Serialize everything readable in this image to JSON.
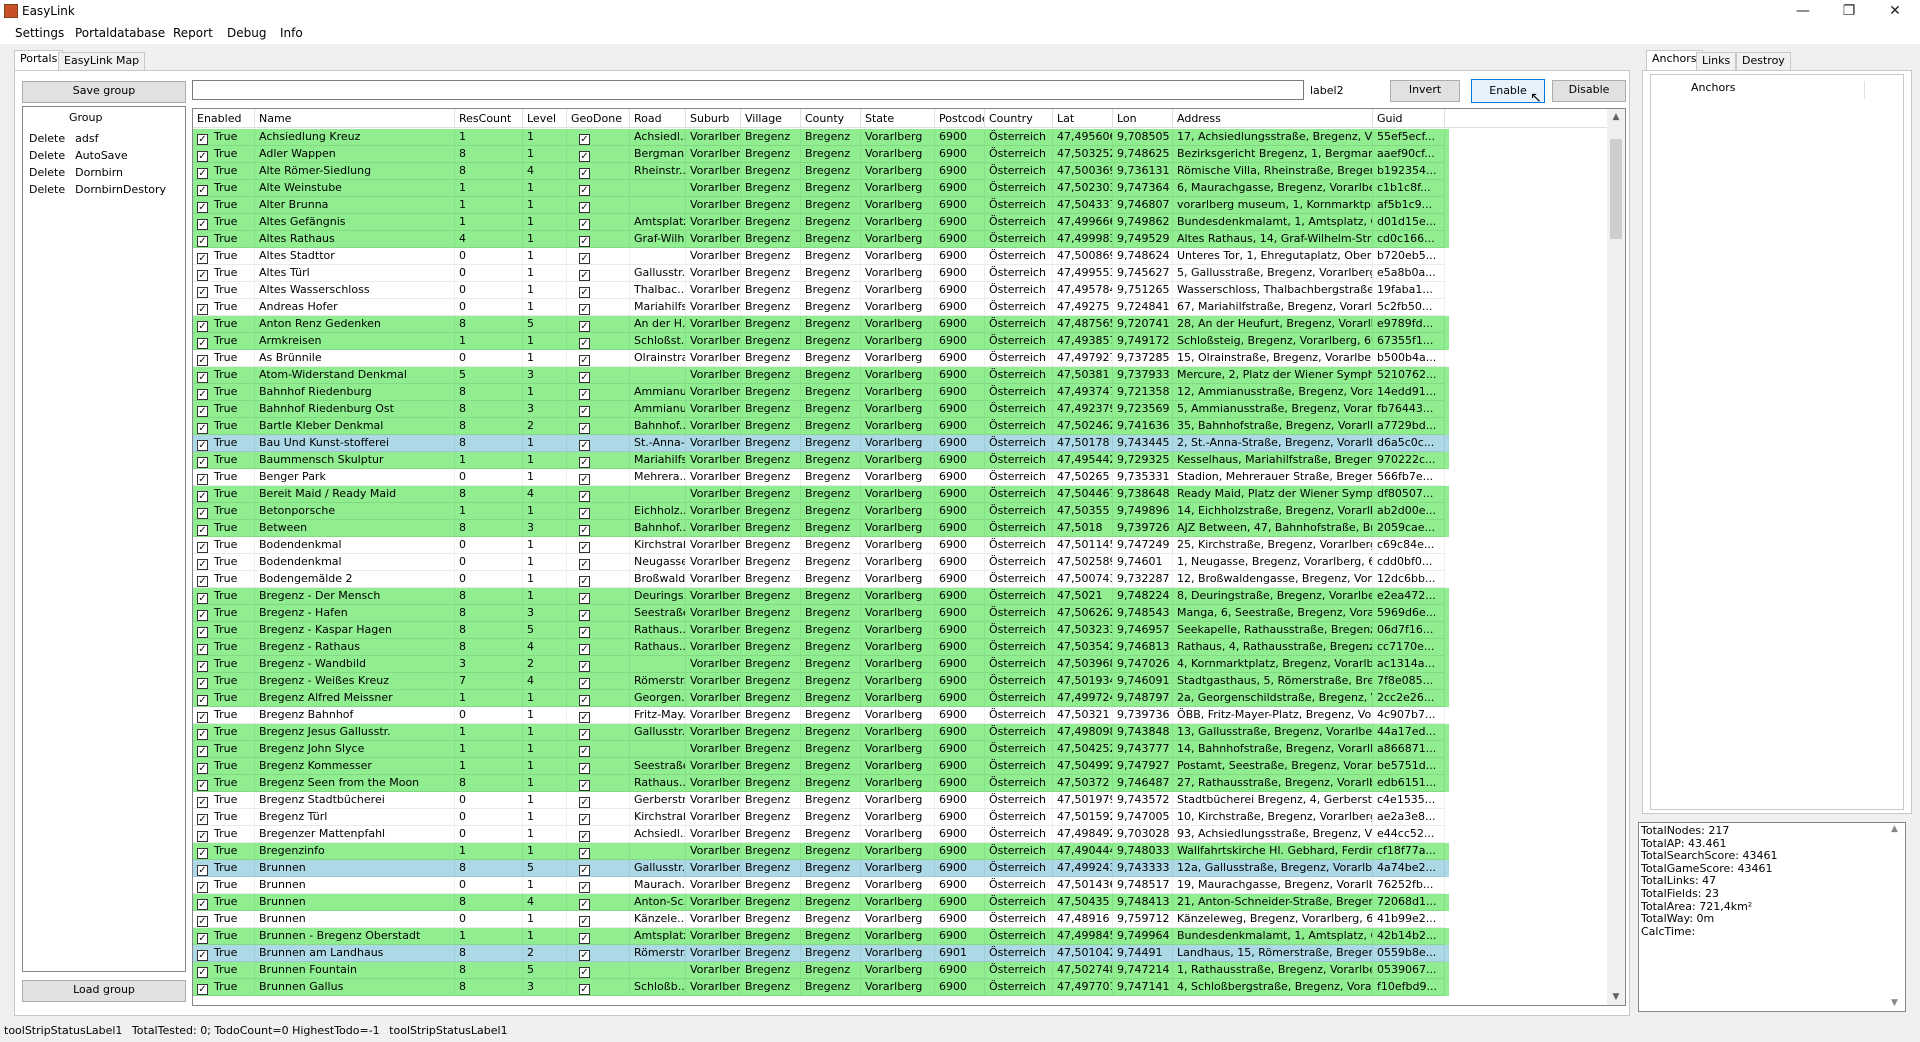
{
  "window": {
    "title": "EasyLink",
    "minimize_icon": "minimize-icon",
    "maximize_icon": "restore-icon",
    "close_icon": "close-icon"
  },
  "menu": [
    "Settings",
    "Portaldatabase",
    "Report",
    "Debug",
    "Info"
  ],
  "tabs": {
    "portals": "Portals",
    "map": "EasyLink Map"
  },
  "toolbar": {
    "save_group": "Save group",
    "search_value": "",
    "label2": "label2",
    "invert": "Invert",
    "enable": "Enable",
    "disable": "Disable",
    "load_group": "Load group"
  },
  "groups": {
    "header": "Group",
    "items": [
      {
        "action": "Delete",
        "name": "adsf"
      },
      {
        "action": "Delete",
        "name": "AutoSave"
      },
      {
        "action": "Delete",
        "name": "Dornbirn"
      },
      {
        "action": "Delete",
        "name": "DornbirnDestory"
      }
    ]
  },
  "grid": {
    "columns": [
      "Enabled",
      "Name",
      "ResCount",
      "Level",
      "GeoDone",
      "Road",
      "Suburb",
      "Village",
      "County",
      "State",
      "Postcode",
      "Country",
      "Lat",
      "Lon",
      "Address",
      "Guid"
    ],
    "rows": [
      {
        "e": "True",
        "n": "Achsiedlung Kreuz",
        "r": "1",
        "l": "1",
        "road": "Achsiedl...",
        "lat": "47,495606",
        "lon": "9,708505",
        "addr": "17, Achsiedlungsstraße, Bregenz, Vorarlb...",
        "guid": "55ef5ecf...",
        "pc": "6900",
        "bg": "green"
      },
      {
        "e": "True",
        "n": "Adler Wappen",
        "r": "8",
        "l": "1",
        "road": "Bergman...",
        "lat": "47,503252",
        "lon": "9,748625",
        "addr": "Bezirksgericht Bregenz, 1, Bergmannstraß...",
        "guid": "aaef90cf...",
        "pc": "6900",
        "bg": "green"
      },
      {
        "e": "True",
        "n": "Alte Römer-Siedlung",
        "r": "8",
        "l": "4",
        "road": "Rheinstr...",
        "lat": "47,500369",
        "lon": "9,736131",
        "addr": "Römische Villa, Rheinstraße, Bregenz, Vor...",
        "guid": "b192354...",
        "pc": "6900",
        "bg": "green"
      },
      {
        "e": "True",
        "n": "Alte Weinstube",
        "r": "1",
        "l": "1",
        "road": "",
        "lat": "47,502303",
        "lon": "9,747364",
        "addr": "6, Maurachgasse, Bregenz, Vorarlberg, 69...",
        "guid": "c1b1c8f...",
        "pc": "6900",
        "bg": "green"
      },
      {
        "e": "True",
        "n": "Alter Brunna",
        "r": "1",
        "l": "1",
        "road": "",
        "lat": "47,504337",
        "lon": "9,746807",
        "addr": "vorarlberg museum, 1, Kornmarktplatz, Bre...",
        "guid": "af5b1c9...",
        "pc": "6900",
        "bg": "green"
      },
      {
        "e": "True",
        "n": "Altes Gefängnis",
        "r": "1",
        "l": "1",
        "road": "Amtsplatz",
        "lat": "47,499666",
        "lon": "9,749862",
        "addr": "Bundesdenkmalamt, 1, Amtsplatz, Obersta...",
        "guid": "d01d15e...",
        "pc": "6900",
        "bg": "green"
      },
      {
        "e": "True",
        "n": "Altes Rathaus",
        "r": "4",
        "l": "1",
        "road": "Graf-Wilh...",
        "lat": "47,499983",
        "lon": "9,749529",
        "addr": "Altes Rathaus, 14, Graf-Wilhelm-Straße, O...",
        "guid": "cd0c166...",
        "pc": "6900",
        "bg": "green"
      },
      {
        "e": "True",
        "n": "Altes Stadttor",
        "r": "0",
        "l": "1",
        "road": "",
        "lat": "47,500869",
        "lon": "9,748624",
        "addr": "Unteres Tor, 1, Ehregutaplatz, Oberstadt, ...",
        "guid": "b720eb5...",
        "pc": "6900",
        "bg": "white"
      },
      {
        "e": "True",
        "n": "Altes Türl",
        "r": "0",
        "l": "1",
        "road": "Gallusstr...",
        "lat": "47,499553",
        "lon": "9,745627",
        "addr": "5, Gallusstraße, Bregenz, Vorarlberg, 6900...",
        "guid": "e5a8b0a...",
        "pc": "6900",
        "bg": "white"
      },
      {
        "e": "True",
        "n": "Altes Wasserschloss",
        "r": "0",
        "l": "1",
        "road": "Thalbac...",
        "lat": "47,495784",
        "lon": "9,751265",
        "addr": "Wasserschloss, Thalbachbergstraße, Bre...",
        "guid": "19faba1...",
        "pc": "6900",
        "bg": "white"
      },
      {
        "e": "True",
        "n": "Andreas Hofer",
        "r": "0",
        "l": "1",
        "road": "Mariahilfs...",
        "lat": "47,49275",
        "lon": "9,724841",
        "addr": "67, Mariahilfstraße, Bregenz, Vorarlberg, 6...",
        "guid": "5c2fb50...",
        "pc": "6900",
        "bg": "white"
      },
      {
        "e": "True",
        "n": "Anton Renz Gedenken",
        "r": "8",
        "l": "5",
        "road": "An der H...",
        "lat": "47,487565",
        "lon": "9,720741",
        "addr": "28, An der Heufurt, Bregenz, Vorarlberg, 6...",
        "guid": "e9789fd...",
        "pc": "6900",
        "bg": "green"
      },
      {
        "e": "True",
        "n": "Armkreisen",
        "r": "1",
        "l": "1",
        "road": "Schloßst...",
        "lat": "47,493857",
        "lon": "9,749172",
        "addr": "Schloßsteig, Bregenz, Vorarlberg, 6900, O...",
        "guid": "67355f1...",
        "pc": "6900",
        "bg": "green"
      },
      {
        "e": "True",
        "n": "As Brünnile",
        "r": "0",
        "l": "1",
        "road": "Olrainstra...",
        "lat": "47,497927",
        "lon": "9,737285",
        "addr": "15, Olrainstraße, Bregenz, Vorarlberg, 690...",
        "guid": "b500b4a...",
        "pc": "6900",
        "bg": "white"
      },
      {
        "e": "True",
        "n": "Atom-Widerstand Denkmal",
        "r": "5",
        "l": "3",
        "road": "",
        "lat": "47,50381",
        "lon": "9,737933",
        "addr": "Mercure, 2, Platz der Wiener Symphoniker...",
        "guid": "5210762...",
        "pc": "6900",
        "bg": "green"
      },
      {
        "e": "True",
        "n": "Bahnhof Riedenburg",
        "r": "8",
        "l": "1",
        "road": "Ammianu...",
        "lat": "47,493747",
        "lon": "9,721358",
        "addr": "12, Ammianusstraße, Bregenz, Vorarlberg,...",
        "guid": "14edd91...",
        "pc": "6900",
        "bg": "green"
      },
      {
        "e": "True",
        "n": "Bahnhof Riedenburg Ost",
        "r": "8",
        "l": "3",
        "road": "Ammianu...",
        "lat": "47,492379",
        "lon": "9,723569",
        "addr": "5, Ammianusstraße, Bregenz, Vorarlberg, ...",
        "guid": "fb76443...",
        "pc": "6900",
        "bg": "green"
      },
      {
        "e": "True",
        "n": "Bartle Kleber Denkmal",
        "r": "8",
        "l": "2",
        "road": "Bahnhof...",
        "lat": "47,502462",
        "lon": "9,741636",
        "addr": "35, Bahnhofstraße, Bregenz, Vorarlberg, 6...",
        "guid": "a7729bd...",
        "pc": "6900",
        "bg": "green"
      },
      {
        "e": "True",
        "n": "Bau Und Kunst-stofferei",
        "r": "8",
        "l": "1",
        "road": "St.-Anna-...",
        "lat": "47,50178",
        "lon": "9,743445",
        "addr": "2, St.-Anna-Straße, Bregenz, Vorarlberg, 6...",
        "guid": "d6a5c0c...",
        "pc": "6900",
        "bg": "blue"
      },
      {
        "e": "True",
        "n": "Baummensch Skulptur",
        "r": "1",
        "l": "1",
        "road": "Mariahilfs...",
        "lat": "47,495442",
        "lon": "9,729325",
        "addr": "Kesselhaus, Mariahilfstraße, Bregenz, Vor...",
        "guid": "970222c...",
        "pc": "6900",
        "bg": "green"
      },
      {
        "e": "True",
        "n": "Benger Park",
        "r": "0",
        "l": "1",
        "road": "Mehrera...",
        "lat": "47,50265",
        "lon": "9,735331",
        "addr": "Stadion, Mehrerauer Straße, Bregenz, V...",
        "guid": "566fb7e...",
        "pc": "6900",
        "bg": "white"
      },
      {
        "e": "True",
        "n": "Bereit Maid / Ready Maid",
        "r": "8",
        "l": "4",
        "road": "",
        "lat": "47,504467",
        "lon": "9,738648",
        "addr": "Ready Maid, Platz der Wiener Symphonik...",
        "guid": "df80507...",
        "pc": "6900",
        "bg": "green"
      },
      {
        "e": "True",
        "n": "Betonporsche",
        "r": "1",
        "l": "1",
        "road": "Eichholz...",
        "lat": "47,50355",
        "lon": "9,749896",
        "addr": "14, Eichholzstraße, Bregenz, Vorarlberg, 6...",
        "guid": "ab2d00e...",
        "pc": "6900",
        "bg": "green"
      },
      {
        "e": "True",
        "n": "Between",
        "r": "8",
        "l": "3",
        "road": "Bahnhof...",
        "lat": "47,5018",
        "lon": "9,739726",
        "addr": "AJZ Between, 47, Bahnhofstraße, Bregen...",
        "guid": "2059cae...",
        "pc": "6900",
        "bg": "green"
      },
      {
        "e": "True",
        "n": "Bodendenkmal",
        "r": "0",
        "l": "1",
        "road": "Kirchstraße",
        "lat": "47,501145",
        "lon": "9,747249",
        "addr": "25, Kirchstraße, Bregenz, Vorarlberg, 690...",
        "guid": "c69c84e...",
        "pc": "6900",
        "bg": "white"
      },
      {
        "e": "True",
        "n": "Bodendenkmal",
        "r": "0",
        "l": "1",
        "road": "Neugasse",
        "lat": "47,502589",
        "lon": "9,74601",
        "addr": "1, Neugasse, Bregenz, Vorarlberg, 6900, ...",
        "guid": "cdd0bf0...",
        "pc": "6900",
        "bg": "white"
      },
      {
        "e": "True",
        "n": "Bodengemälde 2",
        "r": "0",
        "l": "1",
        "road": "Broßwald...",
        "lat": "47,500743",
        "lon": "9,732287",
        "addr": "12, Broßwaldengasse, Bregenz, Vorarlber...",
        "guid": "12dc6bb...",
        "pc": "6900",
        "bg": "white"
      },
      {
        "e": "True",
        "n": "Bregenz - Der Mensch",
        "r": "8",
        "l": "1",
        "road": "Deurings...",
        "lat": "47,5021",
        "lon": "9,748224",
        "addr": "8, Deuringstraße, Bregenz, Vorarlberg, 69...",
        "guid": "e2ea472...",
        "pc": "6900",
        "bg": "green"
      },
      {
        "e": "True",
        "n": "Bregenz - Hafen",
        "r": "8",
        "l": "3",
        "road": "Seestraße",
        "lat": "47,506262",
        "lon": "9,748543",
        "addr": "Manga, 6, Seestraße, Bregenz, Vorarlberg...",
        "guid": "5969d6e...",
        "pc": "6900",
        "bg": "green"
      },
      {
        "e": "True",
        "n": "Bregenz - Kaspar Hagen",
        "r": "8",
        "l": "5",
        "road": "Rathaus...",
        "lat": "47,503233",
        "lon": "9,746957",
        "addr": "Seekapelle, Rathausstraße, Bregenz, Vor...",
        "guid": "06d7f16...",
        "pc": "6900",
        "bg": "green"
      },
      {
        "e": "True",
        "n": "Bregenz - Rathaus",
        "r": "8",
        "l": "4",
        "road": "Rathaus...",
        "lat": "47,503542",
        "lon": "9,746813",
        "addr": "Rathaus, 4, Rathausstraße, Bregenz, Vor...",
        "guid": "cc7170e...",
        "pc": "6900",
        "bg": "green"
      },
      {
        "e": "True",
        "n": "Bregenz - Wandbild",
        "r": "3",
        "l": "2",
        "road": "",
        "lat": "47,503968",
        "lon": "9,747026",
        "addr": "4, Kornmarktplatz, Bregenz, Vorarlberg, 69...",
        "guid": "ac1314a...",
        "pc": "6900",
        "bg": "green"
      },
      {
        "e": "True",
        "n": "Bregenz - Weißes Kreuz",
        "r": "7",
        "l": "4",
        "road": "Römerstr...",
        "lat": "47,501934",
        "lon": "9,746091",
        "addr": "Stadtgasthaus, 5, Römerstraße, Bregenz, ...",
        "guid": "7f8e085...",
        "pc": "6900",
        "bg": "green"
      },
      {
        "e": "True",
        "n": "Bregenz Alfred Meissner",
        "r": "1",
        "l": "1",
        "road": "Georgen...",
        "lat": "47,499724",
        "lon": "9,748797",
        "addr": "2a, Georgenschildstraße, Bregenz, Vorarl...",
        "guid": "2cc2e26...",
        "pc": "6900",
        "bg": "green"
      },
      {
        "e": "True",
        "n": "Bregenz Bahnhof",
        "r": "0",
        "l": "1",
        "road": "Fritz-May...",
        "lat": "47,50321",
        "lon": "9,739736",
        "addr": "ÖBB, Fritz-Mayer-Platz, Bregenz, Vorarlber...",
        "guid": "4c907b7...",
        "pc": "6900",
        "bg": "white"
      },
      {
        "e": "True",
        "n": "Bregenz Jesus Gallusstr.",
        "r": "1",
        "l": "1",
        "road": "Gallusstr...",
        "lat": "47,498098",
        "lon": "9,743848",
        "addr": "13, Gallusstraße, Bregenz, Vorarlberg, 690...",
        "guid": "44a17ed...",
        "pc": "6900",
        "bg": "green"
      },
      {
        "e": "True",
        "n": "Bregenz John Slyce",
        "r": "1",
        "l": "1",
        "road": "",
        "lat": "47,504252",
        "lon": "9,743777",
        "addr": "14, Bahnhofstraße, Bregenz, Vorarlberg, 6...",
        "guid": "a866871...",
        "pc": "6900",
        "bg": "green"
      },
      {
        "e": "True",
        "n": "Bregenz Kommesser",
        "r": "1",
        "l": "1",
        "road": "Seestraße",
        "lat": "47,504992",
        "lon": "9,747927",
        "addr": "Postamt, Seestraße, Bregenz, Vorarlberg, ...",
        "guid": "be5751d...",
        "pc": "6900",
        "bg": "green"
      },
      {
        "e": "True",
        "n": "Bregenz Seen from the Moon",
        "r": "8",
        "l": "1",
        "road": "Rathaus...",
        "lat": "47,50372",
        "lon": "9,746487",
        "addr": "27, Rathausstraße, Bregenz, Vorarlberg, 6...",
        "guid": "edb6151...",
        "pc": "6900",
        "bg": "green"
      },
      {
        "e": "True",
        "n": "Bregenz Stadtbücherei",
        "r": "0",
        "l": "1",
        "road": "Gerberstr...",
        "lat": "47,501979",
        "lon": "9,743572",
        "addr": "Stadtbücherei Bregenz, 4, Gerberstraße, ...",
        "guid": "c4e1535...",
        "pc": "6900",
        "bg": "white"
      },
      {
        "e": "True",
        "n": "Bregenz Türl",
        "r": "0",
        "l": "1",
        "road": "Kirchstraße",
        "lat": "47,501592",
        "lon": "9,747005",
        "addr": "10, Kirchstraße, Bregenz, Vorarlberg, 690...",
        "guid": "ae2a3e8...",
        "pc": "6900",
        "bg": "white"
      },
      {
        "e": "True",
        "n": "Bregenzer Mattenpfahl",
        "r": "0",
        "l": "1",
        "road": "Achsiedl...",
        "lat": "47,498492",
        "lon": "9,703028",
        "addr": "93, Achsiedlungsstraße, Bregenz, Vorarlb...",
        "guid": "e44cc52...",
        "pc": "6900",
        "bg": "white"
      },
      {
        "e": "True",
        "n": "Bregenzinfo",
        "r": "1",
        "l": "1",
        "road": "",
        "lat": "47,490444",
        "lon": "9,748033",
        "addr": "Wallfahrtskirche Hl. Gebhard, Ferdinand-K...",
        "guid": "cf18f77a...",
        "pc": "6900",
        "bg": "green"
      },
      {
        "e": "True",
        "n": "Brunnen",
        "r": "8",
        "l": "5",
        "road": "Gallusstr...",
        "lat": "47,499243",
        "lon": "9,743333",
        "addr": "12a, Gallusstraße, Bregenz, Vorarlberg, 69...",
        "guid": "4a74be2...",
        "pc": "6900",
        "bg": "blue"
      },
      {
        "e": "True",
        "n": "Brunnen",
        "r": "0",
        "l": "1",
        "road": "Maurach...",
        "lat": "47,501436",
        "lon": "9,748517",
        "addr": "19, Maurachgasse, Bregenz, Vorarlberg, 6...",
        "guid": "76252fb...",
        "pc": "6900",
        "bg": "white"
      },
      {
        "e": "True",
        "n": "Brunnen",
        "r": "8",
        "l": "4",
        "road": "Anton-Sc...",
        "lat": "47,50435",
        "lon": "9,748413",
        "addr": "21, Anton-Schneider-Straße, Bregenz, Vor...",
        "guid": "72068d1...",
        "pc": "6900",
        "bg": "green"
      },
      {
        "e": "True",
        "n": "Brunnen",
        "r": "0",
        "l": "1",
        "road": "Känzele...",
        "lat": "47,48916",
        "lon": "9,759712",
        "addr": "Känzeleweg, Bregenz, Vorarlberg, 6900, ...",
        "guid": "41b99e2...",
        "pc": "6900",
        "bg": "white"
      },
      {
        "e": "True",
        "n": "Brunnen - Bregenz Oberstadt",
        "r": "1",
        "l": "1",
        "road": "Amtsplatz",
        "lat": "47,499845",
        "lon": "9,749964",
        "addr": "Bundesdenkmalamt, 1, Amtsplatz, Obersta...",
        "guid": "42b14b2...",
        "pc": "6900",
        "bg": "green"
      },
      {
        "e": "True",
        "n": "Brunnen am Landhaus",
        "r": "8",
        "l": "2",
        "road": "Römerstr...",
        "lat": "47,501042",
        "lon": "9,74491",
        "addr": "Landhaus, 15, Römerstraße, Bregenz, Vor...",
        "guid": "0559b8e...",
        "pc": "6901",
        "bg": "blue"
      },
      {
        "e": "True",
        "n": "Brunnen Fountain",
        "r": "8",
        "l": "5",
        "road": "",
        "lat": "47,502748",
        "lon": "9,747214",
        "addr": "1, Rathausstraße, Bregenz, Vorarlberg, 69...",
        "guid": "0539067...",
        "pc": "6900",
        "bg": "green"
      },
      {
        "e": "True",
        "n": "Brunnen Gallus",
        "r": "8",
        "l": "3",
        "road": "Schloßb...",
        "lat": "47,497701",
        "lon": "9,747141",
        "addr": "4, Schloßbergstraße, Bregenz, Vorarlberg,...",
        "guid": "f10efbd9...",
        "pc": "6900",
        "bg": "green"
      }
    ],
    "common": {
      "suburb": "Vorarlberg",
      "village": "Bregenz",
      "county": "Bregenz",
      "state": "Vorarlberg",
      "country": "Österreich"
    }
  },
  "right_tabs": {
    "anchors": "Anchors",
    "links": "Links",
    "destroy": "Destroy"
  },
  "anchors_header": "Anchors",
  "stats": [
    "TotalNodes: 217",
    "TotalAP: 43.461",
    "TotalSearchScore: 43461",
    "TotalGameScore: 43461",
    "TotalLinks: 47",
    "TotalFields: 23",
    "TotalArea: 721,4km²",
    "TotalWay: 0m",
    "CalcTime:"
  ],
  "statusbar": {
    "label1": "toolStripStatusLabel1",
    "info": "TotalTested: 0; TodoCount=0 HighestTodo=-1",
    "label2": "toolStripStatusLabel1"
  },
  "colors": {
    "enabled_green": "#90ee90",
    "selected_blue": "#add8e6",
    "accent": "#0078d7"
  }
}
